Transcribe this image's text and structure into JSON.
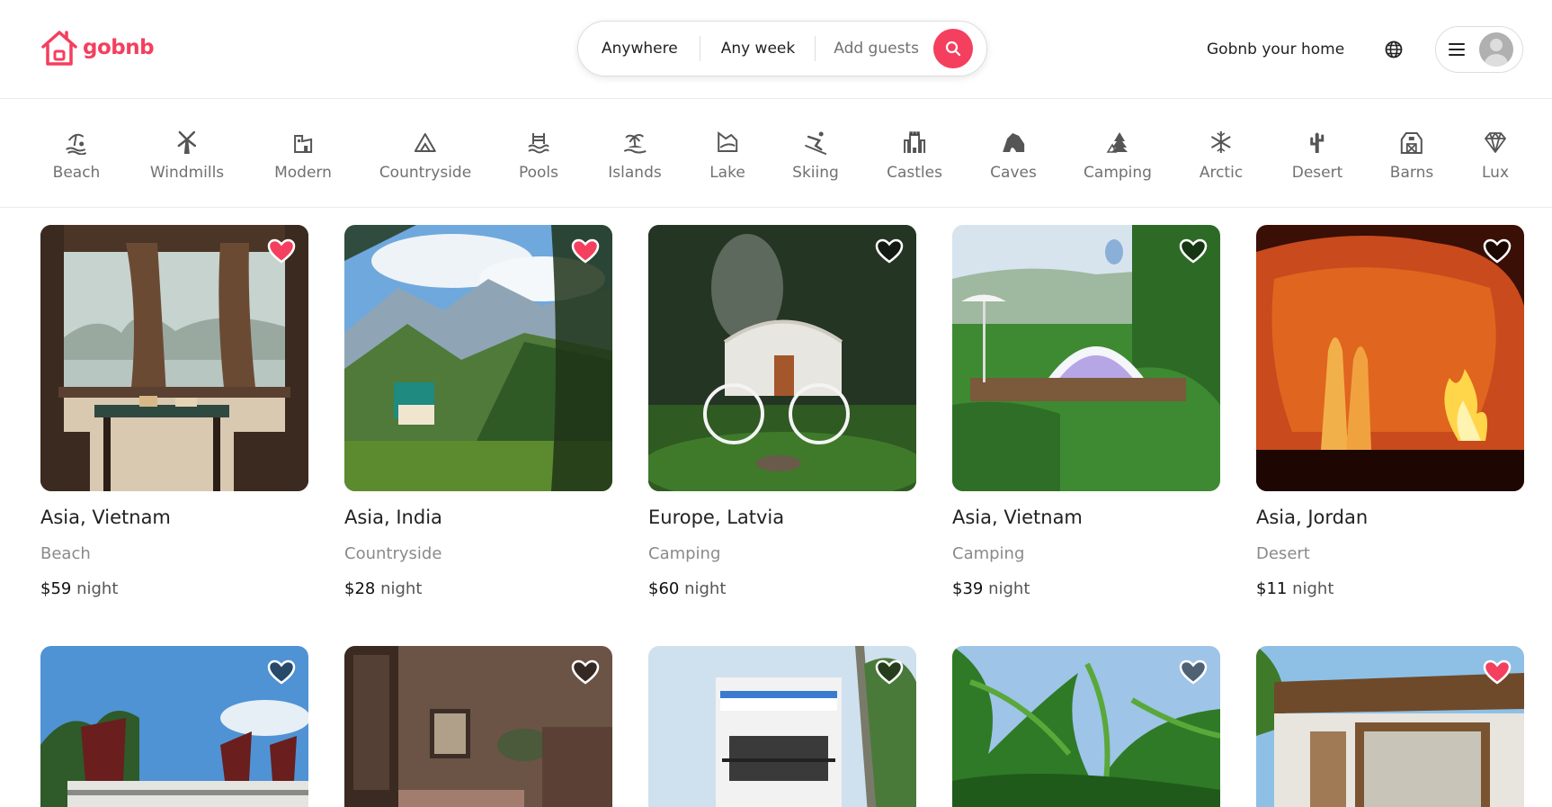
{
  "header": {
    "logo_text": "gobnb",
    "search": {
      "where": "Anywhere",
      "when": "Any week",
      "guests": "Add guests"
    },
    "host_link": "Gobnb your home"
  },
  "categories": [
    {
      "label": "Beach",
      "icon": "beach-icon"
    },
    {
      "label": "Windmills",
      "icon": "windmill-icon"
    },
    {
      "label": "Modern",
      "icon": "modern-house-icon"
    },
    {
      "label": "Countryside",
      "icon": "countryside-icon"
    },
    {
      "label": "Pools",
      "icon": "pool-icon"
    },
    {
      "label": "Islands",
      "icon": "island-icon"
    },
    {
      "label": "Lake",
      "icon": "lake-icon"
    },
    {
      "label": "Skiing",
      "icon": "skiing-icon"
    },
    {
      "label": "Castles",
      "icon": "castle-icon"
    },
    {
      "label": "Caves",
      "icon": "cave-icon"
    },
    {
      "label": "Camping",
      "icon": "camping-icon"
    },
    {
      "label": "Arctic",
      "icon": "snowflake-icon"
    },
    {
      "label": "Desert",
      "icon": "cactus-icon"
    },
    {
      "label": "Barns",
      "icon": "barn-icon"
    },
    {
      "label": "Lux",
      "icon": "diamond-icon"
    }
  ],
  "listings": [
    {
      "location": "Asia, Vietnam",
      "category": "Beach",
      "price": "$59",
      "unit": "night",
      "favorited": true,
      "photo": "restaurant-boat-window-photo"
    },
    {
      "location": "Asia, India",
      "category": "Countryside",
      "price": "$28",
      "unit": "night",
      "favorited": true,
      "photo": "mountain-valley-house-photo"
    },
    {
      "location": "Europe, Latvia",
      "category": "Camping",
      "price": "$60",
      "unit": "night",
      "favorited": false,
      "photo": "yurt-forest-photo"
    },
    {
      "location": "Asia, Vietnam",
      "category": "Camping",
      "price": "$39",
      "unit": "night",
      "favorited": false,
      "photo": "glamping-dome-photo"
    },
    {
      "location": "Asia, Jordan",
      "category": "Desert",
      "price": "$11",
      "unit": "night",
      "favorited": false,
      "photo": "desert-campfire-photo"
    },
    {
      "favorited": false,
      "photo": "junk-boat-bay-photo"
    },
    {
      "favorited": false,
      "photo": "interior-room-photo"
    },
    {
      "favorited": false,
      "photo": "white-building-balcony-photo"
    },
    {
      "favorited": false,
      "photo": "palm-trees-photo"
    },
    {
      "favorited": true,
      "photo": "wooden-cabin-photo"
    }
  ],
  "colors": {
    "brand": "#f43f5e",
    "heart_active": "#f43f5e",
    "text_primary": "#222222",
    "text_secondary": "#717171",
    "border": "#dddddd"
  }
}
